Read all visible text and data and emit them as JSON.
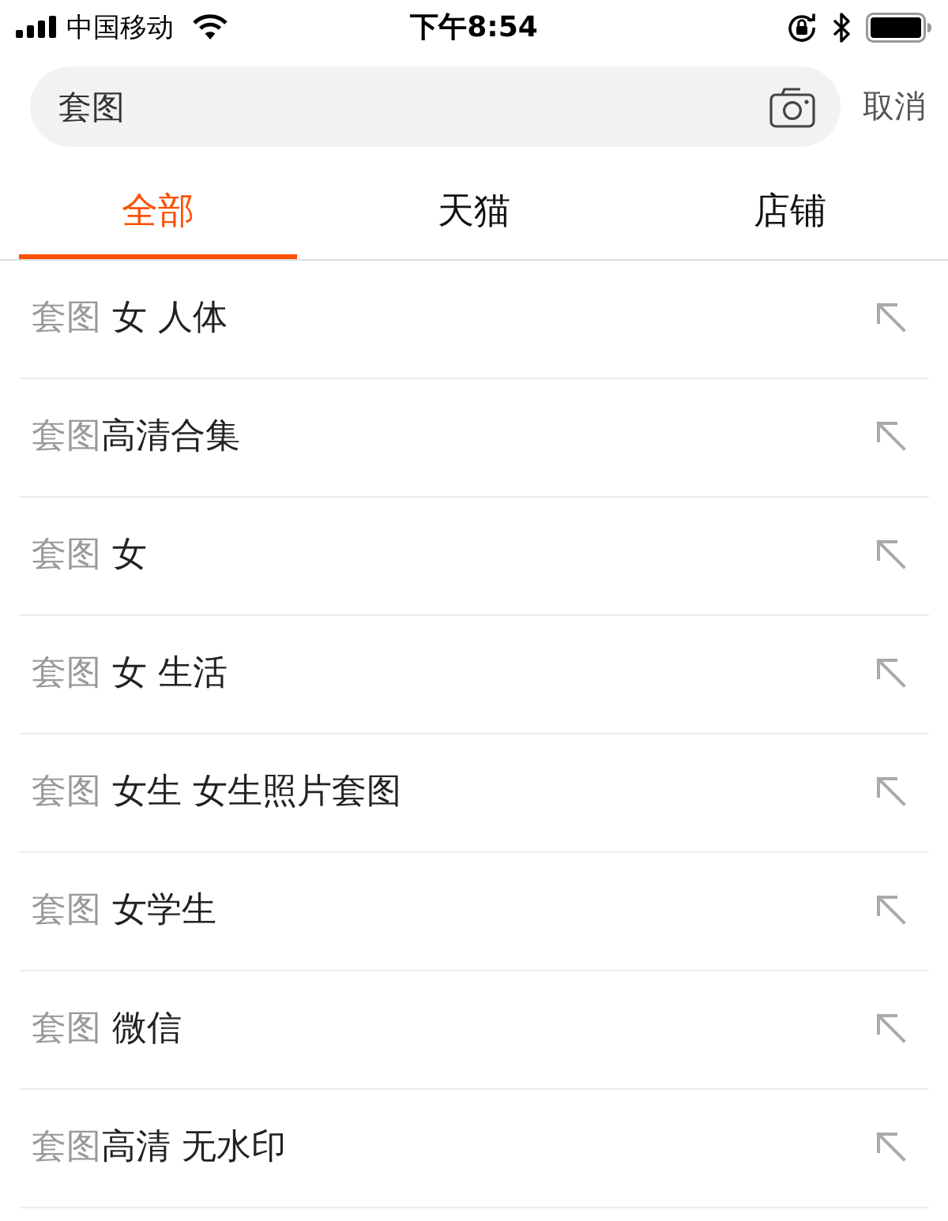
{
  "status_bar": {
    "carrier": "中国移动",
    "time": "下午8:54"
  },
  "search": {
    "value": "套图",
    "cancel": "取消"
  },
  "tabs": [
    {
      "label": "全部",
      "selected": true
    },
    {
      "label": "天猫",
      "selected": false
    },
    {
      "label": "店铺",
      "selected": false
    }
  ],
  "suggestions": [
    {
      "match": "套图",
      "completion": "女 人体",
      "spaced": true
    },
    {
      "match": "套图",
      "completion": "高清合集",
      "spaced": false
    },
    {
      "match": "套图",
      "completion": "女",
      "spaced": true
    },
    {
      "match": "套图",
      "completion": "女 生活",
      "spaced": true
    },
    {
      "match": "套图",
      "completion": "女生 女生照片套图",
      "spaced": true
    },
    {
      "match": "套图",
      "completion": "女学生",
      "spaced": true
    },
    {
      "match": "套图",
      "completion": "微信",
      "spaced": true
    },
    {
      "match": "套图",
      "completion": "高清 无水印",
      "spaced": false
    }
  ]
}
